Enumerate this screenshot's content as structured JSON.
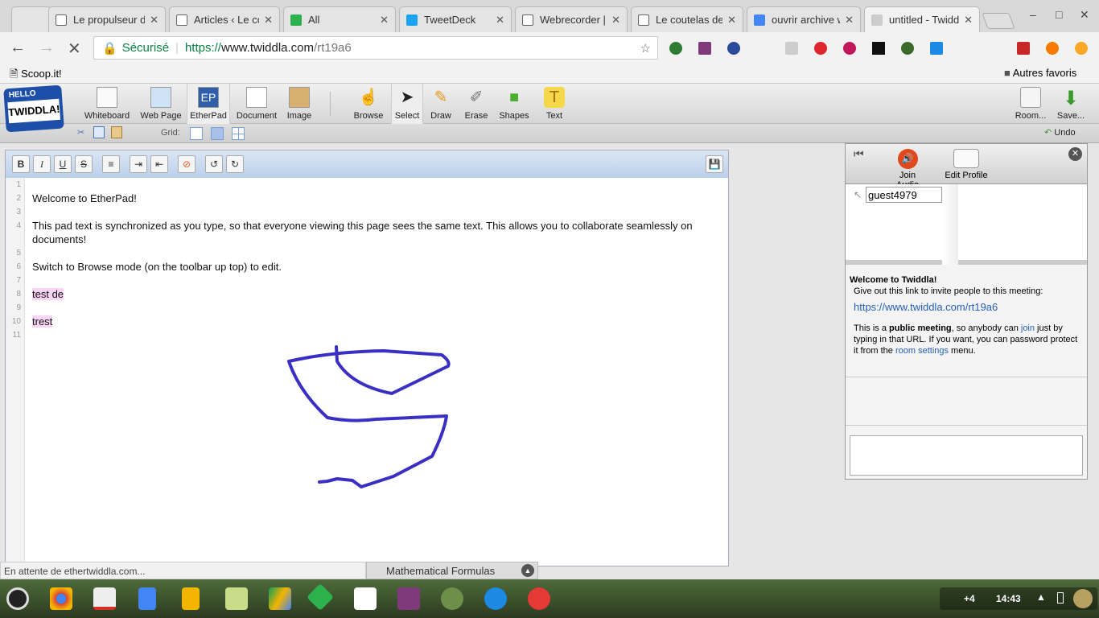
{
  "browser": {
    "tabs": [
      {
        "label": "",
        "icon": "loading-dot"
      },
      {
        "label": "Le propulseur d",
        "icon": "page-icon"
      },
      {
        "label": "Articles ‹ Le co",
        "icon": "page-icon"
      },
      {
        "label": "All",
        "icon": "feedly-icon"
      },
      {
        "label": "TweetDeck",
        "icon": "twitter-icon"
      },
      {
        "label": "Webrecorder |",
        "icon": "page-icon"
      },
      {
        "label": "Le coutelas de",
        "icon": "page-icon"
      },
      {
        "label": "ouvrir archive w",
        "icon": "google-icon"
      },
      {
        "label": "untitled - Twidd",
        "icon": "loading-icon",
        "active": true
      }
    ],
    "secure_label": "Sécurisé",
    "url_scheme": "https://",
    "url_host": "www.twiddla.com",
    "url_path": "/rt19a6",
    "bookmarks": [
      {
        "label": "Scoop.it!"
      }
    ],
    "other_bookmarks": "Autres favoris"
  },
  "toolbar": {
    "logo": "HELLO TWIDDLA!",
    "modes": [
      {
        "label": "Whiteboard"
      },
      {
        "label": "Web Page"
      },
      {
        "label": "EtherPad",
        "selected": true,
        "icon_text": "EP"
      },
      {
        "label": "Document"
      },
      {
        "label": "Image"
      }
    ],
    "tools": [
      {
        "label": "Browse"
      },
      {
        "label": "Select",
        "selected": true
      },
      {
        "label": "Draw"
      },
      {
        "label": "Erase"
      },
      {
        "label": "Shapes"
      },
      {
        "label": "Text",
        "icon_text": "T"
      }
    ],
    "right": [
      {
        "label": "Room..."
      },
      {
        "label": "Save..."
      }
    ],
    "grid_label": "Grid:",
    "undo_label": "Undo"
  },
  "pad": {
    "buttons": [
      "B",
      "I",
      "U",
      "S"
    ],
    "lines": [
      {
        "n": "1",
        "text": ""
      },
      {
        "n": "2",
        "text": "Welcome to EtherPad!"
      },
      {
        "n": "3",
        "text": ""
      },
      {
        "n": "4",
        "text": "This pad text is synchronized as you type, so that everyone viewing this page sees the same text.  This allows you to collaborate seamlessly on documents!"
      },
      {
        "n": "5",
        "text": ""
      },
      {
        "n": "6",
        "text": "Switch to Browse mode (on the toolbar up top) to edit."
      },
      {
        "n": "7",
        "text": ""
      },
      {
        "n": "8",
        "text": "test de ",
        "highlight": true
      },
      {
        "n": "9",
        "text": ""
      },
      {
        "n": "10",
        "text": "trest",
        "highlight": true
      },
      {
        "n": "11",
        "text": ""
      }
    ],
    "stroke_color": "#3a2fc4"
  },
  "sidebar": {
    "join_audio": "Join Audio",
    "edit_profile": "Edit Profile",
    "user_name": "guest4979",
    "user_color": "#2a1fd0",
    "welcome_title": "Welcome to Twiddla!",
    "invite_text": "Give out this link to invite people to this meeting:",
    "invite_link": "https://www.twiddla.com/rt19a6",
    "public_pre": "This is a ",
    "public_bold": "public meeting",
    "public_mid": ", so anybody can ",
    "join_word": "join",
    "public_post": " just by typing in that URL. If you want, you can password protect it from the ",
    "room_settings": "room settings",
    "menu_word": " menu."
  },
  "status": {
    "text": "En attente de ethertwiddla.com...",
    "math": "Mathematical Formulas"
  },
  "shelf": {
    "notif": "+4",
    "time": "14:43"
  }
}
